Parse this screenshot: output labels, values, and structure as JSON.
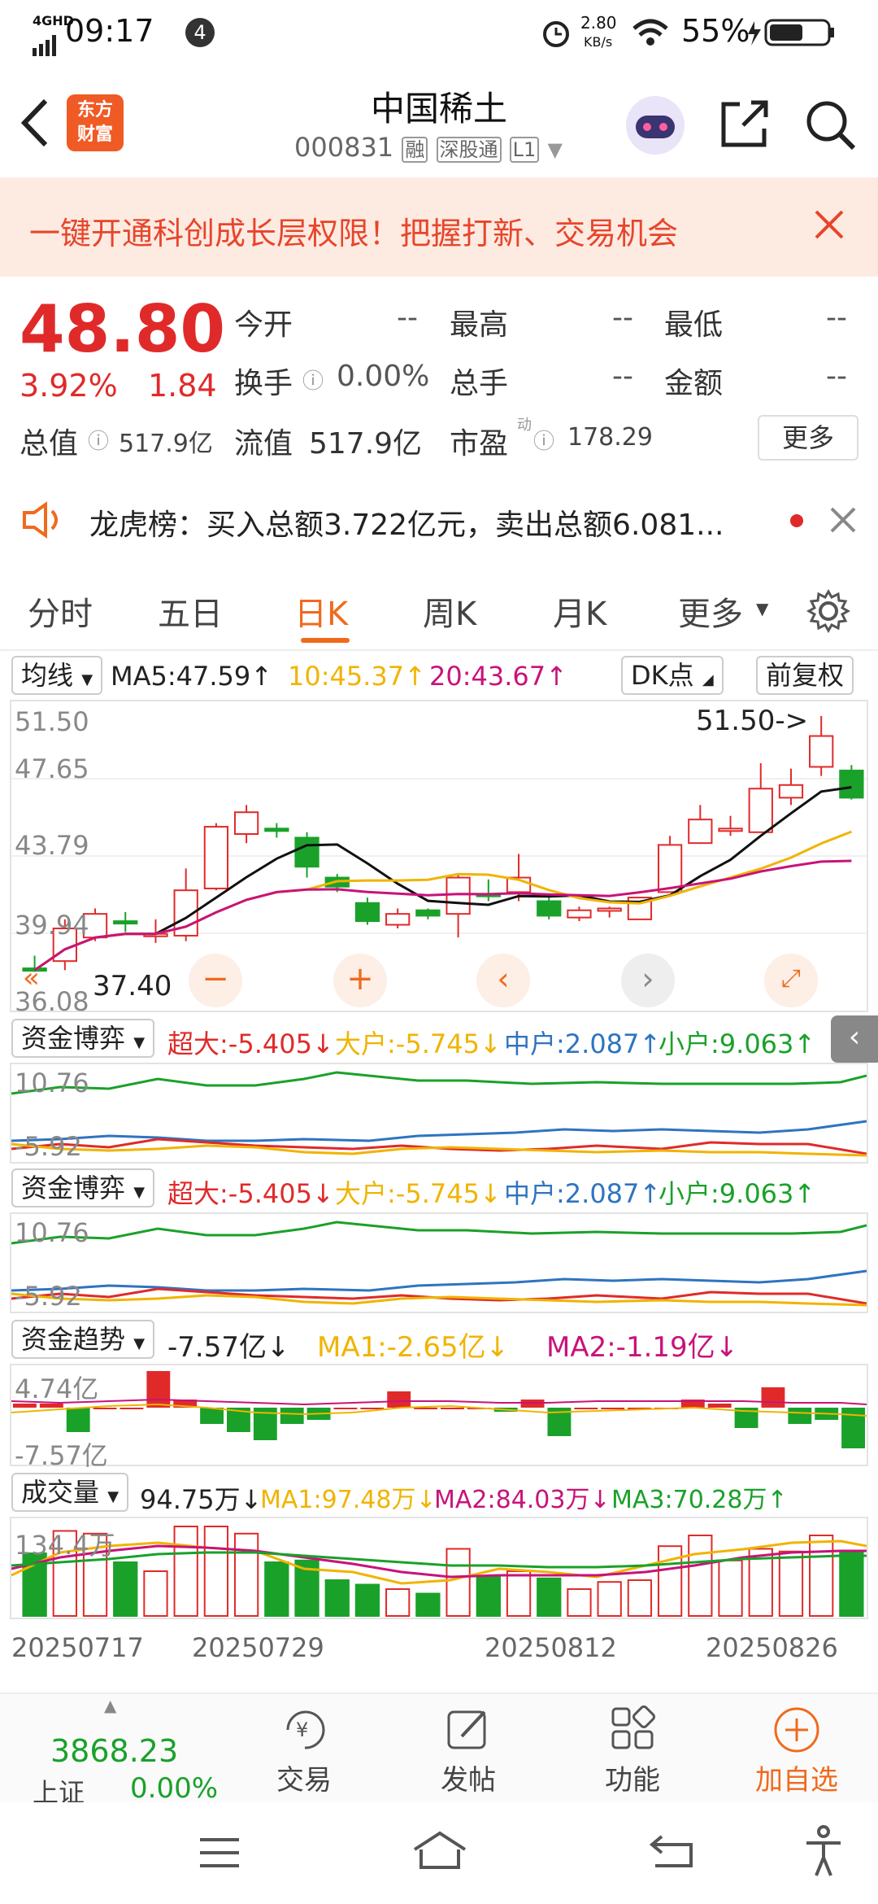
{
  "status": {
    "network": "4GHD",
    "time": "09:17",
    "notif_count": "4",
    "speed": "2.80",
    "speed_unit": "KB/s",
    "battery": "55%"
  },
  "header": {
    "logo_line1": "东方",
    "logo_line2": "财富",
    "title": "中国稀土",
    "code": "000831",
    "tag1": "融",
    "tag2": "深股通",
    "tag3": "L1"
  },
  "banner": {
    "text": "一键开通科创成长层权限！把握打新、交易机会"
  },
  "quote": {
    "price": "48.80",
    "pct": "3.92%",
    "change": "1.84",
    "open_label": "今开",
    "open_val": "--",
    "high_label": "最高",
    "high_val": "--",
    "low_label": "最低",
    "low_val": "--",
    "turnover_label": "换手",
    "turnover_val": "0.00%",
    "volume_label": "总手",
    "volume_val": "--",
    "amount_label": "金额",
    "amount_val": "--",
    "mcap_label": "总值",
    "mcap_val": "517.9亿",
    "float_label": "流值",
    "float_val": "517.9亿",
    "pe_label": "市盈",
    "pe_sup": "动",
    "pe_val": "178.29",
    "more": "更多"
  },
  "lhb": {
    "text": "龙虎榜：买入总额3.722亿元，卖出总额6.081..."
  },
  "tabs": [
    "分时",
    "五日",
    "日K",
    "周K",
    "月K",
    "更多"
  ],
  "ma_row": {
    "select": "均线",
    "ma5": "MA5:47.59↑",
    "ma10": "10:45.37↑",
    "ma20": "20:43.67↑",
    "dk": "DK点",
    "fq": "前复权"
  },
  "kline": {
    "y_top": "51.50",
    "y_2": "47.65",
    "y_3": "43.79",
    "y_4": "39.94",
    "y_bot": "36.08",
    "max_label": "51.50->",
    "min_label": "37.40"
  },
  "fund1": {
    "select": "资金博弈",
    "chaoda": "超大:-5.405↓",
    "dahu": "大户:-5.745↓",
    "zhonghu": "中户:2.087↑",
    "xiaohu": "小户:9.063↑",
    "y_top": "10.76",
    "y_bot": "-5.92"
  },
  "fund2": {
    "select": "资金博弈",
    "chaoda": "超大:-5.405↓",
    "dahu": "大户:-5.745↓",
    "zhonghu": "中户:2.087↑",
    "xiaohu": "小户:9.063↑",
    "y_top": "10.76",
    "y_bot": "-5.92"
  },
  "trend": {
    "select": "资金趋势",
    "value": "-7.57亿↓",
    "ma1": "MA1:-2.65亿↓",
    "ma2": "MA2:-1.19亿↓",
    "y_top": "4.74亿",
    "y_bot": "-7.57亿"
  },
  "vol": {
    "select": "成交量",
    "value": "94.75万↓",
    "ma1": "MA1:97.48万↓",
    "ma2": "MA2:84.03万↓",
    "ma3": "MA3:70.28万↑",
    "y_top": "134.4万"
  },
  "dates": [
    "20250717",
    "20250729",
    "20250812",
    "20250826"
  ],
  "bottom": {
    "index_val": "3868.23",
    "index_name": "上证",
    "index_pct": "0.00%",
    "trade": "交易",
    "post": "发帖",
    "func": "功能",
    "add": "加自选"
  },
  "colors": {
    "up": "#e02a2a",
    "down": "#1aa12a",
    "accent": "#f06a1d"
  },
  "chart_data": {
    "type": "candlestick",
    "ylim": [
      36.08,
      51.5
    ],
    "candles": [
      {
        "o": 37.6,
        "c": 37.5,
        "h": 38.3,
        "l": 37.4
      },
      {
        "o": 38.0,
        "c": 39.8,
        "h": 40.3,
        "l": 37.5
      },
      {
        "o": 39.3,
        "c": 40.6,
        "h": 40.9,
        "l": 39.1
      },
      {
        "o": 40.2,
        "c": 40.1,
        "h": 40.7,
        "l": 39.6
      },
      {
        "o": 39.4,
        "c": 39.5,
        "h": 40.3,
        "l": 39.0
      },
      {
        "o": 39.4,
        "c": 41.9,
        "h": 43.1,
        "l": 39.1
      },
      {
        "o": 42.0,
        "c": 45.4,
        "h": 45.6,
        "l": 41.9
      },
      {
        "o": 45.0,
        "c": 46.2,
        "h": 46.6,
        "l": 44.5
      },
      {
        "o": 45.3,
        "c": 45.2,
        "h": 45.6,
        "l": 44.8
      },
      {
        "o": 44.8,
        "c": 43.2,
        "h": 45.1,
        "l": 42.6
      },
      {
        "o": 42.6,
        "c": 42.1,
        "h": 42.8,
        "l": 41.8
      },
      {
        "o": 41.2,
        "c": 40.2,
        "h": 41.5,
        "l": 40.0
      },
      {
        "o": 40.0,
        "c": 40.6,
        "h": 40.9,
        "l": 39.8
      },
      {
        "o": 40.8,
        "c": 40.5,
        "h": 40.9,
        "l": 40.3
      },
      {
        "o": 40.6,
        "c": 42.6,
        "h": 42.8,
        "l": 39.3
      },
      {
        "o": 41.7,
        "c": 41.6,
        "h": 42.5,
        "l": 41.3
      },
      {
        "o": 41.8,
        "c": 42.6,
        "h": 43.9,
        "l": 41.3
      },
      {
        "o": 41.3,
        "c": 40.5,
        "h": 41.6,
        "l": 40.3
      },
      {
        "o": 40.4,
        "c": 40.8,
        "h": 41.0,
        "l": 40.2
      },
      {
        "o": 40.9,
        "c": 40.9,
        "h": 41.0,
        "l": 40.4
      },
      {
        "o": 40.3,
        "c": 41.5,
        "h": 41.5,
        "l": 40.3
      },
      {
        "o": 41.8,
        "c": 44.4,
        "h": 44.9,
        "l": 41.8
      },
      {
        "o": 44.5,
        "c": 45.8,
        "h": 46.6,
        "l": 44.5
      },
      {
        "o": 45.2,
        "c": 45.3,
        "h": 46.0,
        "l": 44.9
      },
      {
        "o": 45.1,
        "c": 47.5,
        "h": 48.9,
        "l": 45.1
      },
      {
        "o": 47.0,
        "c": 47.7,
        "h": 48.6,
        "l": 46.6
      },
      {
        "o": 48.7,
        "c": 50.4,
        "h": 51.5,
        "l": 48.2
      },
      {
        "o": 48.5,
        "c": 47.0,
        "h": 48.8,
        "l": 46.9
      }
    ]
  }
}
